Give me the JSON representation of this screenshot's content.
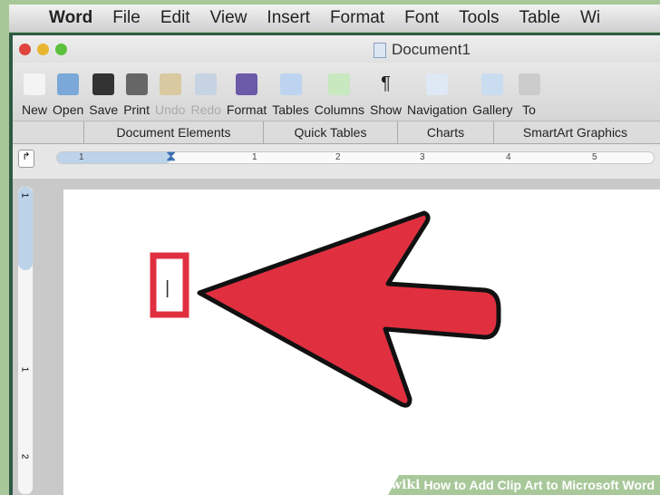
{
  "menubar": {
    "items": [
      "Word",
      "File",
      "Edit",
      "View",
      "Insert",
      "Format",
      "Font",
      "Tools",
      "Table",
      "Wi"
    ]
  },
  "window": {
    "title": "Document1"
  },
  "toolbar": {
    "buttons": [
      {
        "label": "New",
        "icon": "new-doc-icon",
        "enabled": true
      },
      {
        "label": "Open",
        "icon": "open-folder-icon",
        "enabled": true
      },
      {
        "label": "Save",
        "icon": "floppy-disk-icon",
        "enabled": true
      },
      {
        "label": "Print",
        "icon": "printer-icon",
        "enabled": true
      },
      {
        "label": "Undo",
        "icon": "undo-icon",
        "enabled": false
      },
      {
        "label": "Redo",
        "icon": "redo-icon",
        "enabled": false
      },
      {
        "label": "Format",
        "icon": "paintbrush-icon",
        "enabled": true
      },
      {
        "label": "Tables",
        "icon": "table-grid-icon",
        "enabled": true
      },
      {
        "label": "Columns",
        "icon": "columns-icon",
        "enabled": true
      },
      {
        "label": "Show",
        "icon": "pilcrow-icon",
        "enabled": true
      },
      {
        "label": "Navigation",
        "icon": "navigation-pane-icon",
        "enabled": true
      },
      {
        "label": "Gallery",
        "icon": "gallery-icon",
        "enabled": true
      },
      {
        "label": "To",
        "icon": "toolbox-icon",
        "enabled": true
      }
    ]
  },
  "ribbon_tabs": [
    "Document Elements",
    "Quick Tables",
    "Charts",
    "SmartArt Graphics"
  ],
  "ruler": {
    "labels": [
      "1",
      "1",
      "2",
      "3",
      "4",
      "5"
    ],
    "vertical_labels": [
      "1",
      "1",
      "2"
    ]
  },
  "document": {
    "cursor": "|"
  },
  "annotation": {
    "arrow_color": "#e03040",
    "box_color": "#e03040"
  },
  "watermark": {
    "brand": "wiki",
    "title": "How to Add Clip Art to Microsoft Word"
  }
}
